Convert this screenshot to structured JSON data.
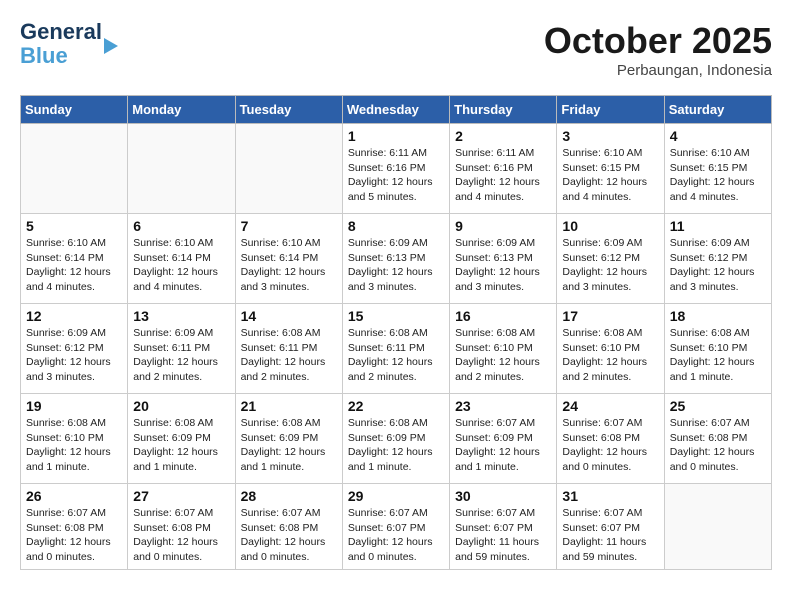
{
  "header": {
    "logo_line1": "General",
    "logo_line2": "Blue",
    "month": "October 2025",
    "location": "Perbaungan, Indonesia"
  },
  "days_of_week": [
    "Sunday",
    "Monday",
    "Tuesday",
    "Wednesday",
    "Thursday",
    "Friday",
    "Saturday"
  ],
  "weeks": [
    [
      {
        "day": "",
        "info": ""
      },
      {
        "day": "",
        "info": ""
      },
      {
        "day": "",
        "info": ""
      },
      {
        "day": "1",
        "info": "Sunrise: 6:11 AM\nSunset: 6:16 PM\nDaylight: 12 hours\nand 5 minutes."
      },
      {
        "day": "2",
        "info": "Sunrise: 6:11 AM\nSunset: 6:16 PM\nDaylight: 12 hours\nand 4 minutes."
      },
      {
        "day": "3",
        "info": "Sunrise: 6:10 AM\nSunset: 6:15 PM\nDaylight: 12 hours\nand 4 minutes."
      },
      {
        "day": "4",
        "info": "Sunrise: 6:10 AM\nSunset: 6:15 PM\nDaylight: 12 hours\nand 4 minutes."
      }
    ],
    [
      {
        "day": "5",
        "info": "Sunrise: 6:10 AM\nSunset: 6:14 PM\nDaylight: 12 hours\nand 4 minutes."
      },
      {
        "day": "6",
        "info": "Sunrise: 6:10 AM\nSunset: 6:14 PM\nDaylight: 12 hours\nand 4 minutes."
      },
      {
        "day": "7",
        "info": "Sunrise: 6:10 AM\nSunset: 6:14 PM\nDaylight: 12 hours\nand 3 minutes."
      },
      {
        "day": "8",
        "info": "Sunrise: 6:09 AM\nSunset: 6:13 PM\nDaylight: 12 hours\nand 3 minutes."
      },
      {
        "day": "9",
        "info": "Sunrise: 6:09 AM\nSunset: 6:13 PM\nDaylight: 12 hours\nand 3 minutes."
      },
      {
        "day": "10",
        "info": "Sunrise: 6:09 AM\nSunset: 6:12 PM\nDaylight: 12 hours\nand 3 minutes."
      },
      {
        "day": "11",
        "info": "Sunrise: 6:09 AM\nSunset: 6:12 PM\nDaylight: 12 hours\nand 3 minutes."
      }
    ],
    [
      {
        "day": "12",
        "info": "Sunrise: 6:09 AM\nSunset: 6:12 PM\nDaylight: 12 hours\nand 3 minutes."
      },
      {
        "day": "13",
        "info": "Sunrise: 6:09 AM\nSunset: 6:11 PM\nDaylight: 12 hours\nand 2 minutes."
      },
      {
        "day": "14",
        "info": "Sunrise: 6:08 AM\nSunset: 6:11 PM\nDaylight: 12 hours\nand 2 minutes."
      },
      {
        "day": "15",
        "info": "Sunrise: 6:08 AM\nSunset: 6:11 PM\nDaylight: 12 hours\nand 2 minutes."
      },
      {
        "day": "16",
        "info": "Sunrise: 6:08 AM\nSunset: 6:10 PM\nDaylight: 12 hours\nand 2 minutes."
      },
      {
        "day": "17",
        "info": "Sunrise: 6:08 AM\nSunset: 6:10 PM\nDaylight: 12 hours\nand 2 minutes."
      },
      {
        "day": "18",
        "info": "Sunrise: 6:08 AM\nSunset: 6:10 PM\nDaylight: 12 hours\nand 1 minute."
      }
    ],
    [
      {
        "day": "19",
        "info": "Sunrise: 6:08 AM\nSunset: 6:10 PM\nDaylight: 12 hours\nand 1 minute."
      },
      {
        "day": "20",
        "info": "Sunrise: 6:08 AM\nSunset: 6:09 PM\nDaylight: 12 hours\nand 1 minute."
      },
      {
        "day": "21",
        "info": "Sunrise: 6:08 AM\nSunset: 6:09 PM\nDaylight: 12 hours\nand 1 minute."
      },
      {
        "day": "22",
        "info": "Sunrise: 6:08 AM\nSunset: 6:09 PM\nDaylight: 12 hours\nand 1 minute."
      },
      {
        "day": "23",
        "info": "Sunrise: 6:07 AM\nSunset: 6:09 PM\nDaylight: 12 hours\nand 1 minute."
      },
      {
        "day": "24",
        "info": "Sunrise: 6:07 AM\nSunset: 6:08 PM\nDaylight: 12 hours\nand 0 minutes."
      },
      {
        "day": "25",
        "info": "Sunrise: 6:07 AM\nSunset: 6:08 PM\nDaylight: 12 hours\nand 0 minutes."
      }
    ],
    [
      {
        "day": "26",
        "info": "Sunrise: 6:07 AM\nSunset: 6:08 PM\nDaylight: 12 hours\nand 0 minutes."
      },
      {
        "day": "27",
        "info": "Sunrise: 6:07 AM\nSunset: 6:08 PM\nDaylight: 12 hours\nand 0 minutes."
      },
      {
        "day": "28",
        "info": "Sunrise: 6:07 AM\nSunset: 6:08 PM\nDaylight: 12 hours\nand 0 minutes."
      },
      {
        "day": "29",
        "info": "Sunrise: 6:07 AM\nSunset: 6:07 PM\nDaylight: 12 hours\nand 0 minutes."
      },
      {
        "day": "30",
        "info": "Sunrise: 6:07 AM\nSunset: 6:07 PM\nDaylight: 11 hours\nand 59 minutes."
      },
      {
        "day": "31",
        "info": "Sunrise: 6:07 AM\nSunset: 6:07 PM\nDaylight: 11 hours\nand 59 minutes."
      },
      {
        "day": "",
        "info": ""
      }
    ]
  ]
}
